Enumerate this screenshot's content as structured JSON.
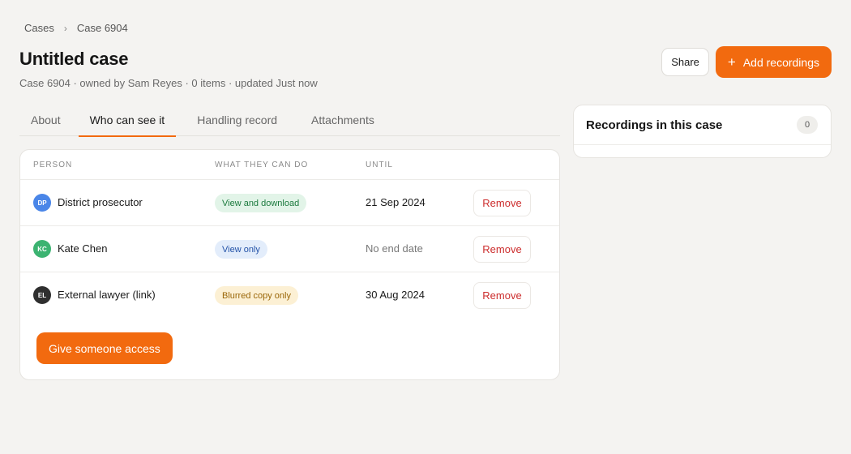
{
  "breadcrumb": {
    "root": "Cases",
    "separator": "›",
    "current": "Case 6904"
  },
  "page": {
    "title": "Untitled case",
    "subtitle": "Case 6904 · owned by Sam Reyes · 0 items · updated Just now"
  },
  "actions": {
    "share_label": "Share",
    "add_recordings_label": "Add recordings",
    "add_icon": "plus-icon"
  },
  "tabs": [
    {
      "label": "About",
      "active": false
    },
    {
      "label": "Who can see it",
      "active": true
    },
    {
      "label": "Handling record",
      "active": false
    },
    {
      "label": "Attachments",
      "active": false
    }
  ],
  "access_table": {
    "columns": {
      "person": "PERSON",
      "permission": "WHAT THEY CAN DO",
      "until": "UNTIL"
    },
    "rows": [
      {
        "initials": "DP",
        "avatar_color": "#4a86e8",
        "name": "District prosecutor",
        "permission": "View and download",
        "permission_style": "green",
        "until": "21 Sep 2024",
        "remove_label": "Remove"
      },
      {
        "initials": "KC",
        "avatar_color": "#3cb371",
        "name": "Kate Chen",
        "permission": "View only",
        "permission_style": "blue",
        "until": "No end date",
        "remove_label": "Remove"
      },
      {
        "initials": "EL",
        "avatar_color": "#2f2f2f",
        "name": "External lawyer (link)",
        "permission": "Blurred copy only",
        "permission_style": "amber",
        "until": "30 Aug 2024",
        "remove_label": "Remove"
      }
    ],
    "give_access_label": "Give someone access"
  },
  "recordings": {
    "title": "Recordings in this case",
    "count": "0"
  },
  "colors": {
    "accent": "#f26a0f",
    "remove": "#cc2d2d"
  }
}
